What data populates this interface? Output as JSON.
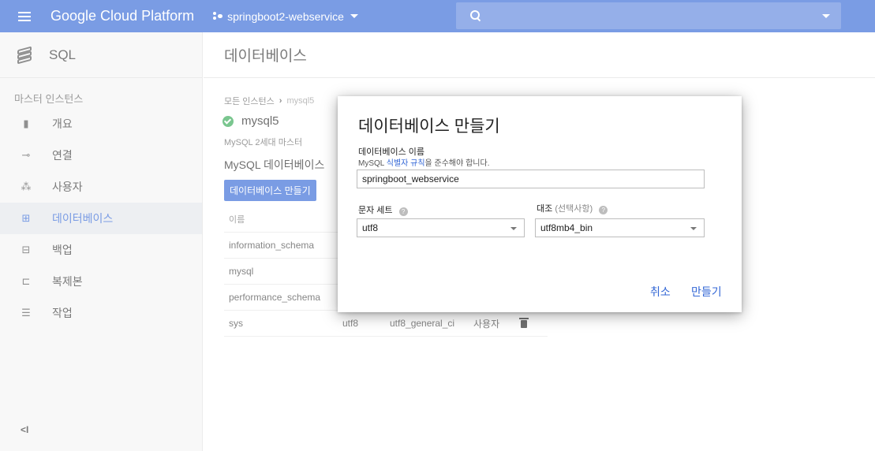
{
  "topbar": {
    "brand": "Google Cloud Platform",
    "project": "springboot2-webservice",
    "color": "#3367d6"
  },
  "sidebar": {
    "product": "SQL",
    "section_label": "마스터 인스턴스",
    "items": [
      {
        "label": "개요",
        "icon": "overview-icon",
        "active": false
      },
      {
        "label": "연결",
        "icon": "connection-icon",
        "active": false
      },
      {
        "label": "사용자",
        "icon": "users-icon",
        "active": false
      },
      {
        "label": "데이터베이스",
        "icon": "database-icon",
        "active": true
      },
      {
        "label": "백업",
        "icon": "backup-icon",
        "active": false
      },
      {
        "label": "복제본",
        "icon": "replica-icon",
        "active": false
      },
      {
        "label": "작업",
        "icon": "tasks-icon",
        "active": false
      }
    ],
    "collapse": "<I"
  },
  "main": {
    "page_title": "데이터베이스",
    "breadcrumb": {
      "root": "모든 인스턴스",
      "current": "mysql5"
    },
    "instance_name": "mysql5",
    "instance_sub": "MySQL 2세대 마스터",
    "section_title": "MySQL 데이터베이스",
    "create_button": "데이터베이스 만들기",
    "table": {
      "header": "이름",
      "rows": [
        {
          "name": "information_schema",
          "charset": "",
          "collation": "",
          "type": ""
        },
        {
          "name": "mysql",
          "charset": "",
          "collation": "",
          "type": ""
        },
        {
          "name": "performance_schema",
          "charset": "",
          "collation": "",
          "type": ""
        },
        {
          "name": "sys",
          "charset": "utf8",
          "collation": "utf8_general_ci",
          "type": "사용자"
        }
      ]
    }
  },
  "dialog": {
    "title": "데이터베이스 만들기",
    "name_label": "데이터베이스 이름",
    "hint_prefix": "MySQL ",
    "hint_link": "식별자 규칙",
    "hint_suffix": "을 준수해야 합니다.",
    "name_value": "springboot_webservice",
    "charset_label": "문자 세트",
    "charset_value": "utf8",
    "collation_label": "대조",
    "collation_optional": "(선택사항)",
    "collation_value": "utf8mb4_bin",
    "cancel": "취소",
    "create": "만들기"
  }
}
